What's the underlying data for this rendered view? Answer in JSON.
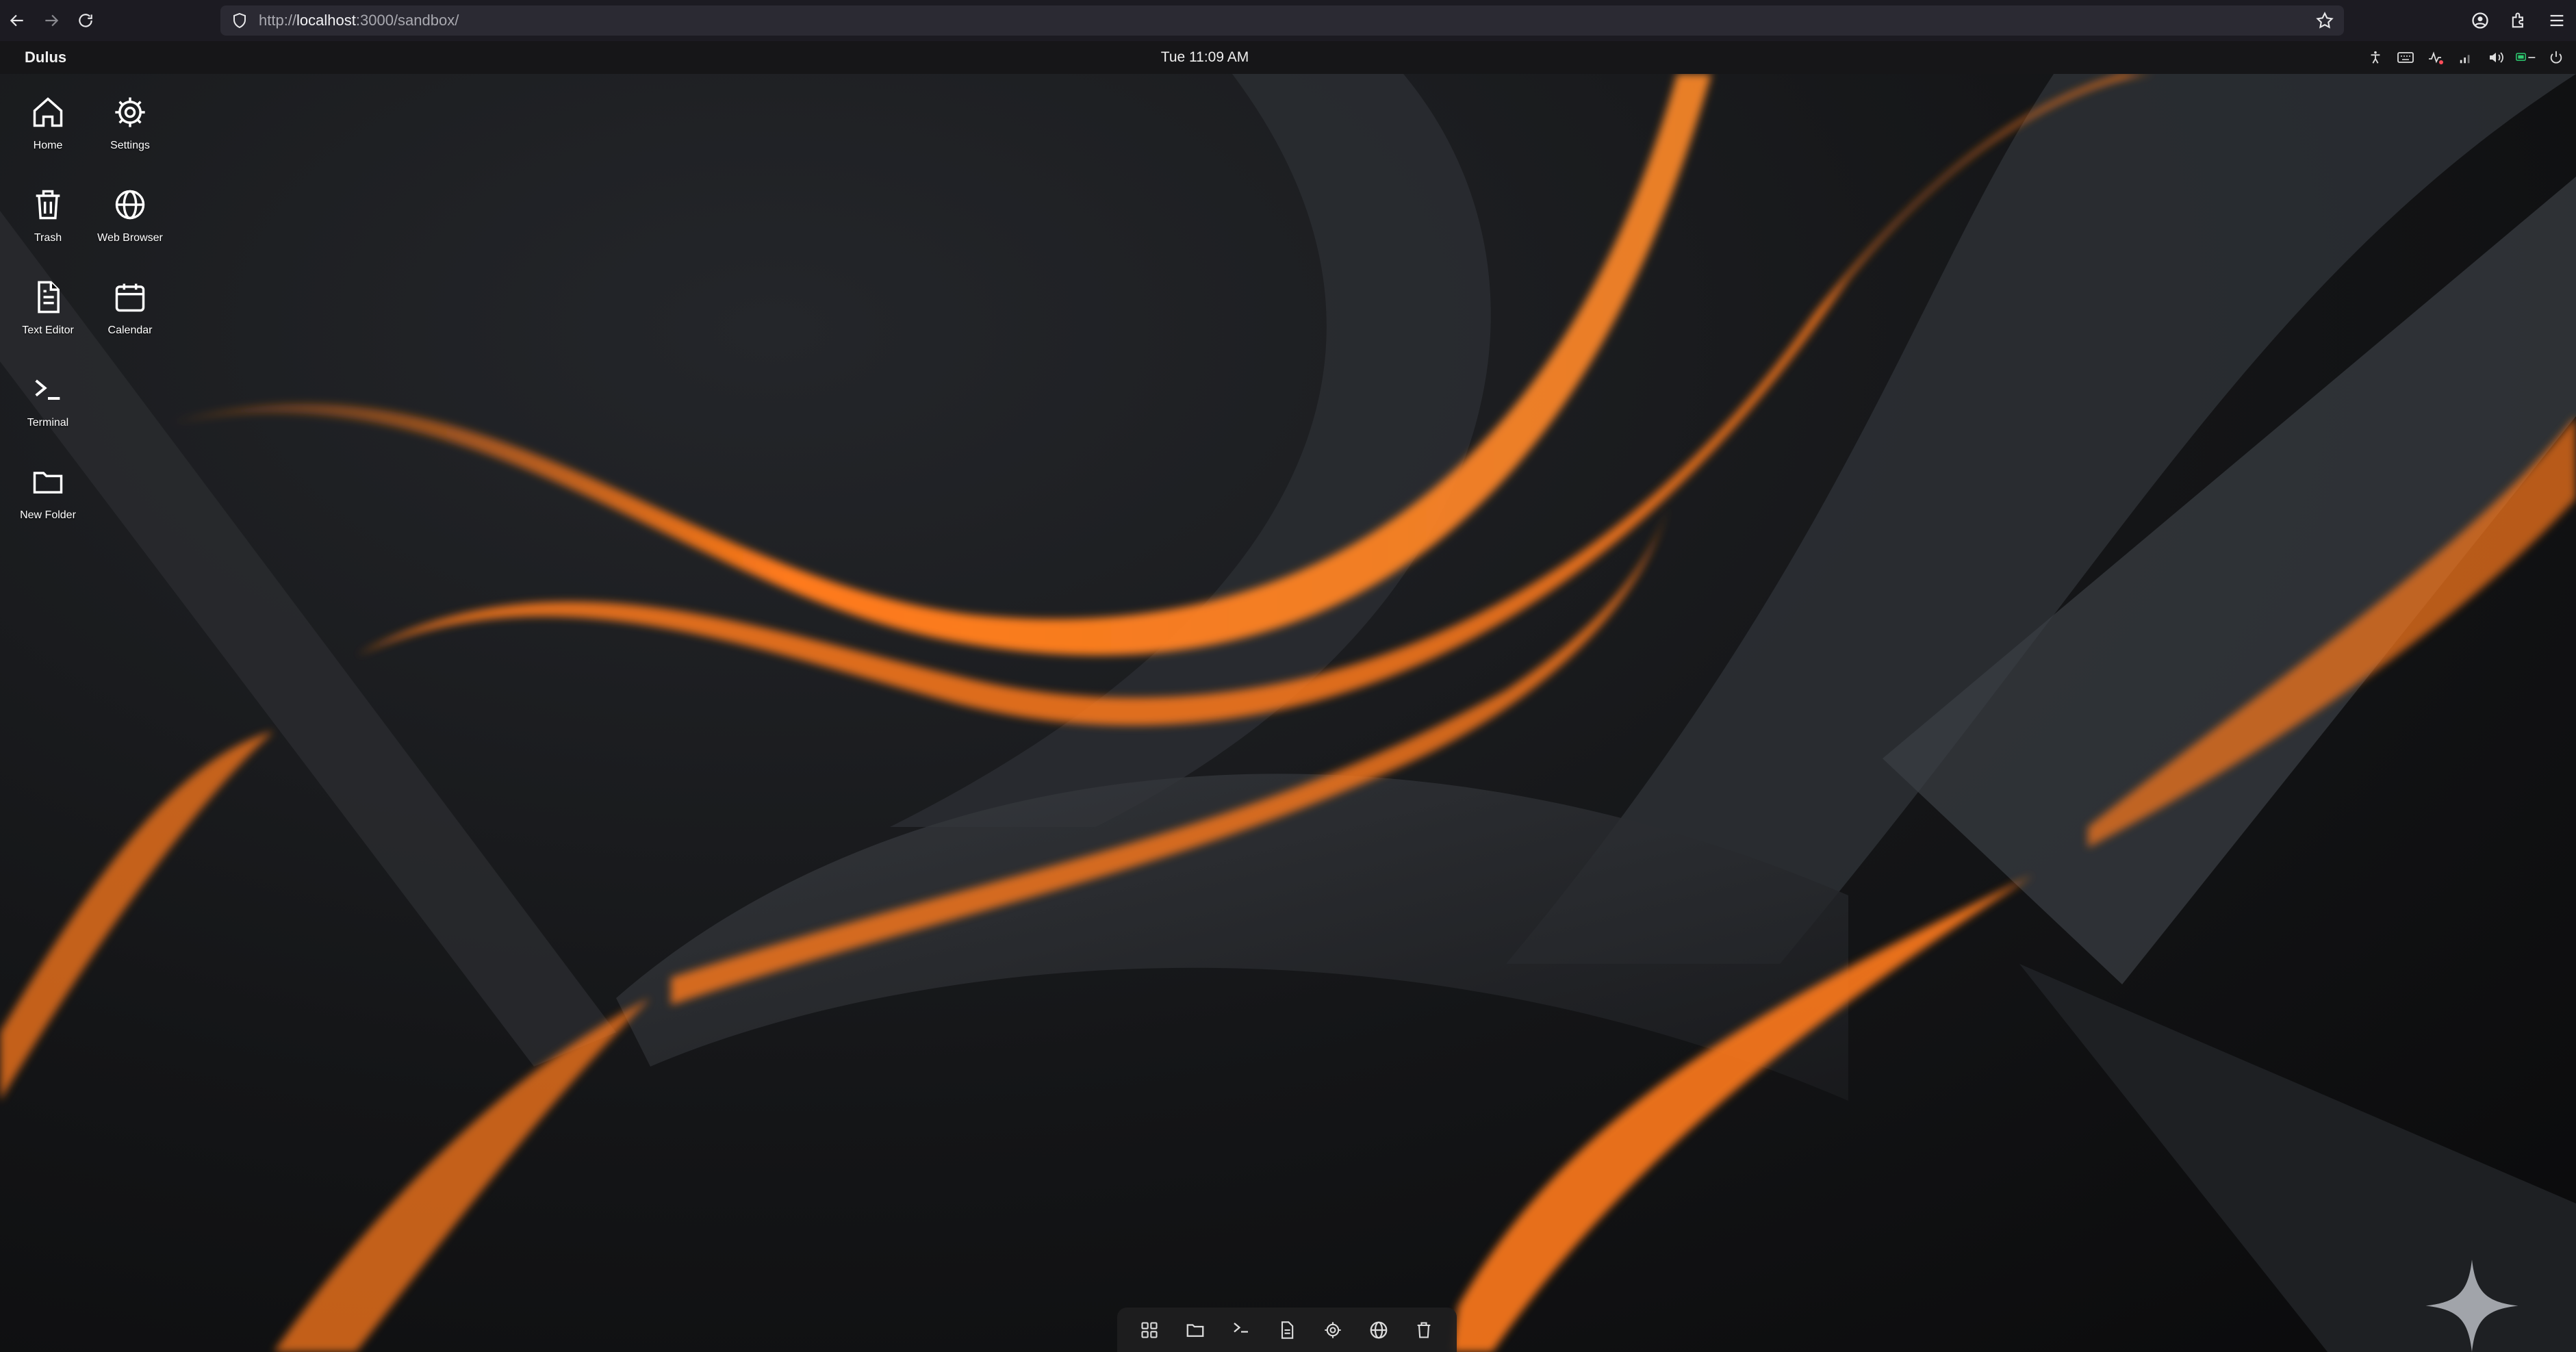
{
  "browser": {
    "url_prefix": "http://",
    "url_host": "localhost",
    "url_rest": ":3000/sandbox/"
  },
  "panel": {
    "app_name": "Dulus",
    "clock": "Tue 11:09 AM"
  },
  "desktop_icons": [
    {
      "label": "Home",
      "icon": "home-icon"
    },
    {
      "label": "Settings",
      "icon": "gear-icon"
    },
    {
      "label": "Trash",
      "icon": "trash-icon"
    },
    {
      "label": "Web Browser",
      "icon": "globe-icon"
    },
    {
      "label": "Text Editor",
      "icon": "document-icon"
    },
    {
      "label": "Calendar",
      "icon": "calendar-icon"
    },
    {
      "label": "Terminal",
      "icon": "terminal-icon"
    },
    {
      "label": "New Folder",
      "icon": "folder-icon"
    }
  ],
  "dock": [
    "grid-icon",
    "folder-icon",
    "terminal-icon",
    "document-icon",
    "gear-icon",
    "globe-icon",
    "trash-icon"
  ],
  "colors": {
    "accent_orange": "#ff7a1a",
    "background_dark": "#121315",
    "panel": "#161618",
    "browser_chrome": "#1c1b22"
  }
}
